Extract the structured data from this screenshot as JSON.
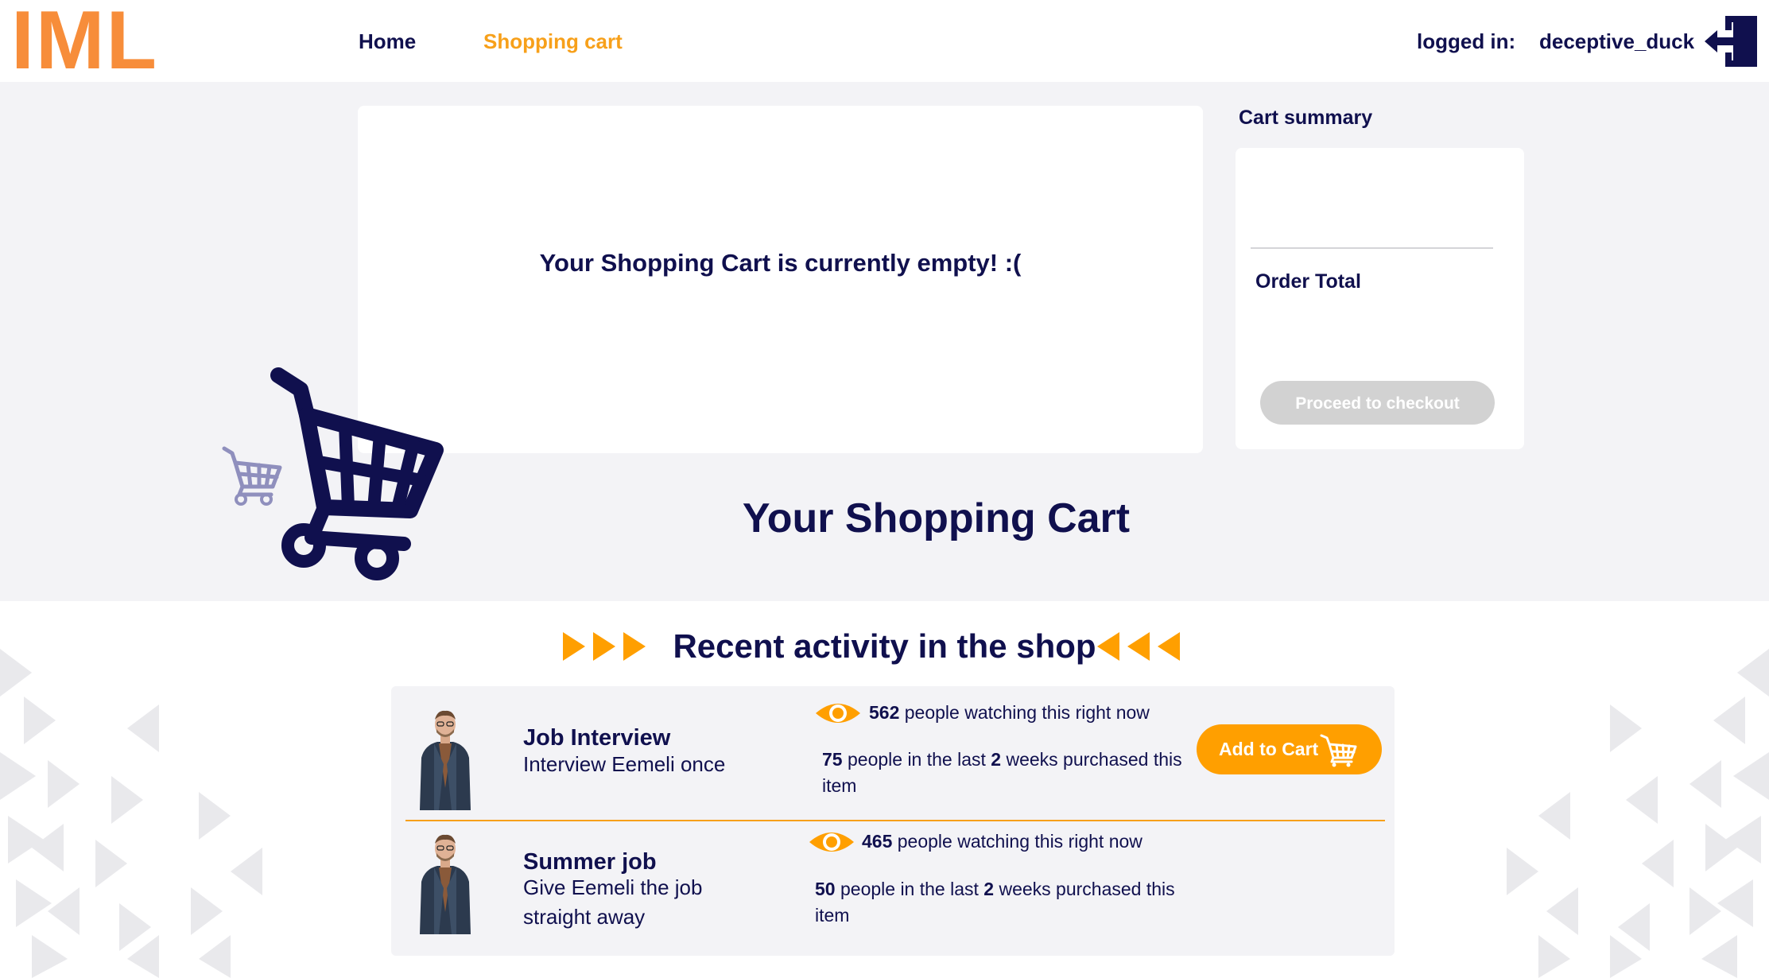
{
  "brand": {
    "logo": "IML",
    "logo_color": "#f78d3a"
  },
  "nav": {
    "items": [
      {
        "label": "Home",
        "active": false
      },
      {
        "label": "Shopping cart",
        "active": true
      }
    ],
    "active_color": "#f7a01a"
  },
  "user": {
    "logged_in_label": "logged in:",
    "username": "deceptive_duck"
  },
  "cart": {
    "empty_message": "Your Shopping Cart is currently empty! :(",
    "page_heading": "Your Shopping Cart"
  },
  "summary": {
    "title": "Cart summary",
    "order_total_label": "Order Total",
    "checkout_label": "Proceed to checkout"
  },
  "activity": {
    "heading": "Recent activity in the shop",
    "items": [
      {
        "title": "Job Interview",
        "description": "Interview Eemeli once",
        "watching_count": "562",
        "watching_text": "people watching this right now",
        "purchased_count": "75",
        "purchased_text_a": "people in the last",
        "purchased_weeks": "2",
        "purchased_text_b": "weeks purchased this item",
        "add_to_cart_label": "Add to Cart"
      },
      {
        "title": "Summer job",
        "description": "Give Eemeli the job straight away",
        "watching_count": "465",
        "watching_text": "people watching this right now",
        "purchased_count": "50",
        "purchased_text_a": "people in the last",
        "purchased_weeks": "2",
        "purchased_text_b": "weeks purchased this item"
      }
    ]
  },
  "colors": {
    "navy": "#10104e",
    "orange": "#ff9f00",
    "background": "#f3f3f6",
    "disabled_button": "#d2d2d2"
  }
}
